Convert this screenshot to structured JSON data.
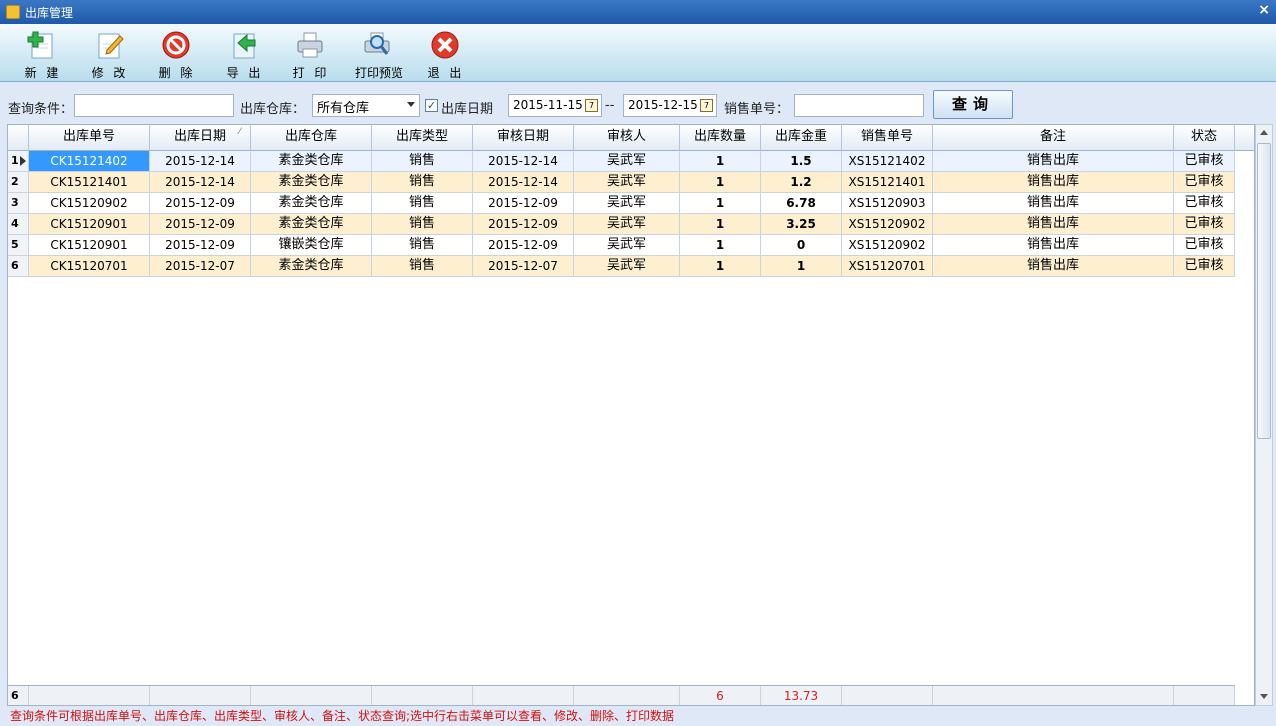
{
  "window": {
    "title": "出库管理",
    "close": "×"
  },
  "toolbar": [
    {
      "label": "新 建",
      "icon": "plus-document-icon"
    },
    {
      "label": "修 改",
      "icon": "edit-document-icon"
    },
    {
      "label": "删 除",
      "icon": "delete-icon"
    },
    {
      "label": "导 出",
      "icon": "export-arrow-icon"
    },
    {
      "label": "打 印",
      "icon": "printer-icon"
    },
    {
      "label": "打印预览",
      "icon": "print-preview-icon"
    },
    {
      "label": "退 出",
      "icon": "exit-icon"
    }
  ],
  "filters": {
    "query_label": "查询条件：",
    "query_value": "",
    "warehouse_label": "出库仓库：",
    "warehouse_value": "所有仓库",
    "date_checked": true,
    "date_label": "出库日期",
    "date_from": "2015-11-15",
    "date_sep": "--",
    "date_to": "2015-12-15",
    "sales_no_label": "销售单号：",
    "sales_no_value": "",
    "query_button": "查询"
  },
  "table": {
    "columns": [
      "出库单号",
      "出库日期",
      "出库仓库",
      "出库类型",
      "审核日期",
      "审核人",
      "出库数量",
      "出库金重",
      "销售单号",
      "备注",
      "状态"
    ],
    "rows": [
      {
        "n": "1",
        "c": [
          "CK15121402",
          "2015-12-14",
          "素金类仓库",
          "销售",
          "2015-12-14",
          "吴武军",
          "1",
          "1.5",
          "XS15121402",
          "销售出库",
          "已审核"
        ]
      },
      {
        "n": "2",
        "c": [
          "CK15121401",
          "2015-12-14",
          "素金类仓库",
          "销售",
          "2015-12-14",
          "吴武军",
          "1",
          "1.2",
          "XS15121401",
          "销售出库",
          "已审核"
        ]
      },
      {
        "n": "3",
        "c": [
          "CK15120902",
          "2015-12-09",
          "素金类仓库",
          "销售",
          "2015-12-09",
          "吴武军",
          "1",
          "6.78",
          "XS15120903",
          "销售出库",
          "已审核"
        ]
      },
      {
        "n": "4",
        "c": [
          "CK15120901",
          "2015-12-09",
          "素金类仓库",
          "销售",
          "2015-12-09",
          "吴武军",
          "1",
          "3.25",
          "XS15120902",
          "销售出库",
          "已审核"
        ]
      },
      {
        "n": "5",
        "c": [
          "CK15120901",
          "2015-12-09",
          "镶嵌类仓库",
          "销售",
          "2015-12-09",
          "吴武军",
          "1",
          "0",
          "XS15120902",
          "销售出库",
          "已审核"
        ]
      },
      {
        "n": "6",
        "c": [
          "CK15120701",
          "2015-12-07",
          "素金类仓库",
          "销售",
          "2015-12-07",
          "吴武军",
          "1",
          "1",
          "XS15120701",
          "销售出库",
          "已审核"
        ]
      }
    ],
    "footer": {
      "count": "6",
      "total_qty": "6",
      "total_weight": "13.73"
    }
  },
  "status_bar": "查询条件可根据出库单号、出库仓库、出库类型、审核人、备注、状态查询;选中行右击菜单可以查看、修改、删除、打印数据"
}
